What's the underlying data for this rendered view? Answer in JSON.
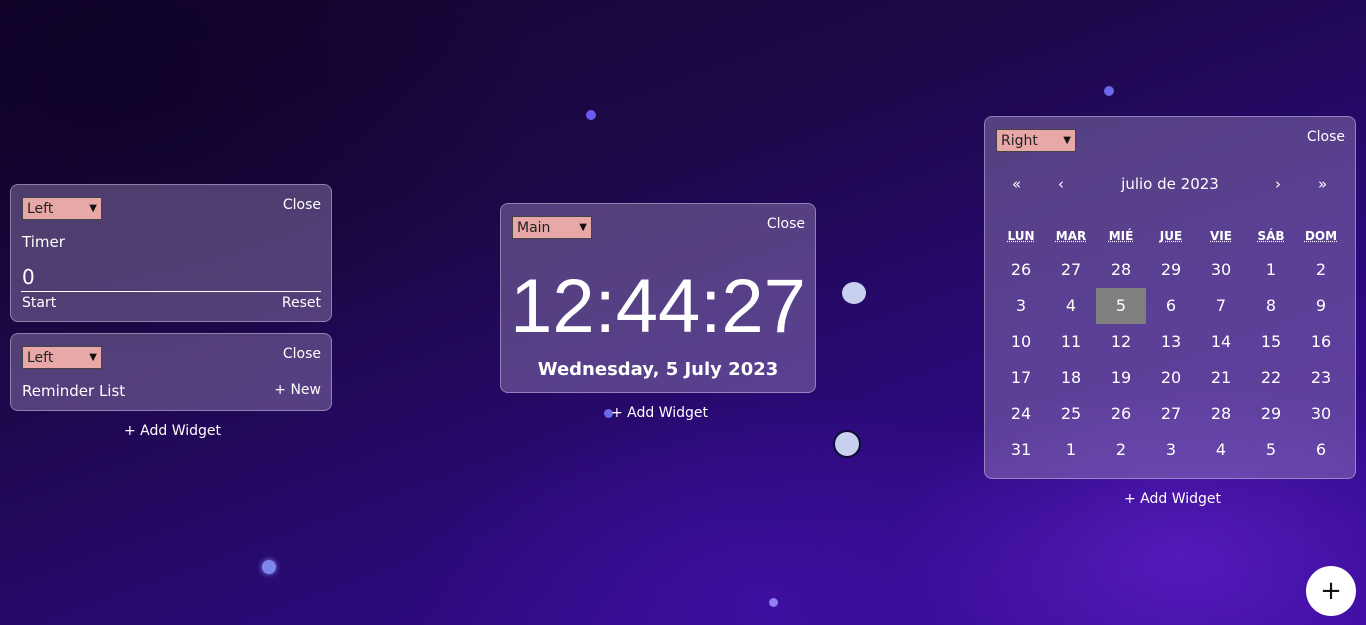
{
  "left_column": {
    "timer_widget": {
      "position_select": "Left",
      "close_label": "Close",
      "title": "Timer",
      "value": "0",
      "start_label": "Start",
      "reset_label": "Reset"
    },
    "reminder_widget": {
      "position_select": "Left",
      "close_label": "Close",
      "title": "Reminder List",
      "new_label": "+ New"
    },
    "add_widget_label": "+ Add Widget"
  },
  "center_column": {
    "clock_widget": {
      "position_select": "Main",
      "close_label": "Close",
      "time": "12:44:27",
      "date": "Wednesday, 5 July 2023"
    },
    "add_widget_label": "+ Add Widget"
  },
  "right_column": {
    "calendar_widget": {
      "position_select": "Right",
      "close_label": "Close",
      "nav": {
        "prev_year": "«",
        "prev_month": "‹",
        "month_label": "julio de 2023",
        "next_month": "›",
        "next_year": "»"
      },
      "weekdays": [
        "LUN",
        "MAR",
        "MIÉ",
        "JUE",
        "VIE",
        "SÁB",
        "DOM"
      ],
      "weeks": [
        [
          "26",
          "27",
          "28",
          "29",
          "30",
          "1",
          "2"
        ],
        [
          "3",
          "4",
          "5",
          "6",
          "7",
          "8",
          "9"
        ],
        [
          "10",
          "11",
          "12",
          "13",
          "14",
          "15",
          "16"
        ],
        [
          "17",
          "18",
          "19",
          "20",
          "21",
          "22",
          "23"
        ],
        [
          "24",
          "25",
          "26",
          "27",
          "28",
          "29",
          "30"
        ],
        [
          "31",
          "1",
          "2",
          "3",
          "4",
          "5",
          "6"
        ]
      ],
      "selected_day": "5"
    },
    "add_widget_label": "+ Add Widget"
  },
  "fab": {
    "label": "+"
  },
  "colors": {
    "select_bg": "#e8a8a8",
    "selected_day_bg": "#7f7f80",
    "panel_bg": "rgba(160,140,190,0.42)"
  }
}
